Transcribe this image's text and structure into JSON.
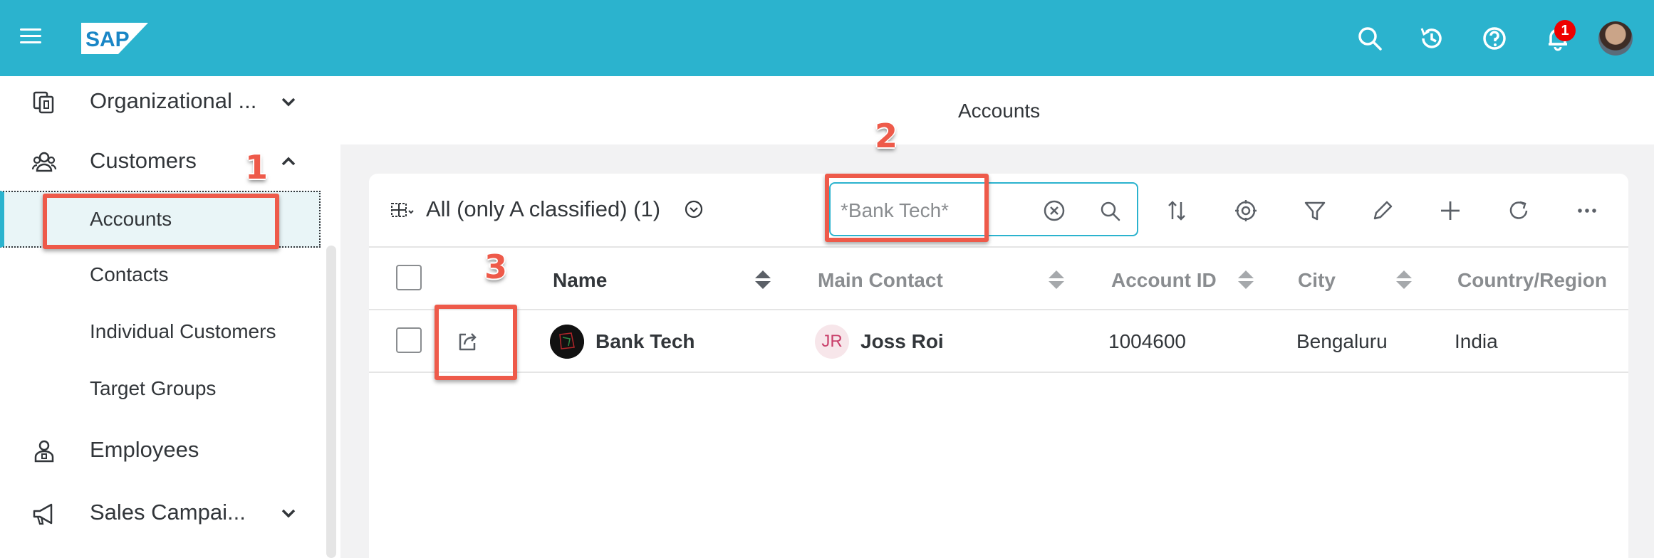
{
  "header": {
    "logo_text": "SAP",
    "notification_count": "1",
    "icons": [
      "menu-icon",
      "search-icon",
      "history-icon",
      "help-icon",
      "bell-icon"
    ],
    "brand_color": "#2bb3ce"
  },
  "sidebar": {
    "items": [
      {
        "label": "Organizational ...",
        "icon": "org-units-icon",
        "expanded": false
      },
      {
        "label": "Customers",
        "icon": "customers-icon",
        "expanded": true
      },
      {
        "label": "Employees",
        "icon": "employees-icon",
        "expanded": false
      },
      {
        "label": "Sales Campai...",
        "icon": "megaphone-icon",
        "expanded": false
      }
    ],
    "sub_items": [
      "Accounts",
      "Contacts",
      "Individual Customers",
      "Target Groups"
    ],
    "active_sub_item": "Accounts"
  },
  "page": {
    "title": "Accounts"
  },
  "list": {
    "view_title": "All (only A classified)  (1)",
    "search_value": "*Bank Tech*",
    "toolbar_icons": [
      "sort-icon",
      "settings-icon",
      "filter-icon",
      "edit-icon",
      "add-icon",
      "refresh-icon",
      "more-icon"
    ],
    "columns": [
      "Name",
      "Main Contact",
      "Account ID",
      "City",
      "Country/Region"
    ],
    "rows": [
      {
        "name": "Bank Tech",
        "contact_initials": "JR",
        "contact": "Joss Roi",
        "account_id": "1004600",
        "city": "Bengaluru",
        "country": "India"
      }
    ]
  },
  "annotations": {
    "step1": "1",
    "step2": "2",
    "step3": "3",
    "color": "#ee5a4a"
  }
}
